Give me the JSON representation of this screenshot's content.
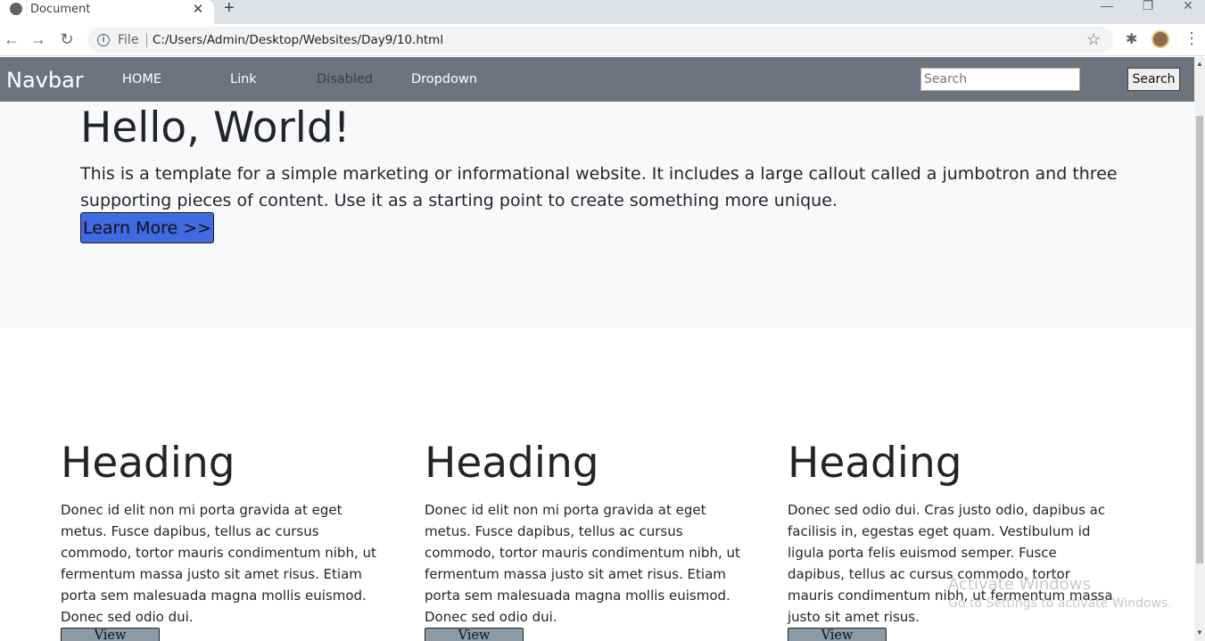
{
  "browser": {
    "tab_title": "Document",
    "new_tab": "+",
    "close_tab": "✕",
    "window_controls": {
      "minimize": "—",
      "restore": "❐",
      "close": "✕"
    },
    "nav": {
      "back": "←",
      "forward": "→",
      "reload": "↻"
    },
    "omnibox": {
      "scheme_label": "File",
      "url": "C:/Users/Admin/Desktop/Websites/Day9/10.html"
    },
    "star": "☆",
    "extensions": "✱",
    "menu": "⋮"
  },
  "navbar": {
    "brand": "Navbar",
    "links": [
      {
        "label": "HOME"
      },
      {
        "label": "Link"
      },
      {
        "label": "Disabled"
      },
      {
        "label": "Dropdown"
      }
    ],
    "search": {
      "placeholder": "Search",
      "button_label": "Search"
    }
  },
  "jumbotron": {
    "title": "Hello, World!",
    "text": "This is a template for a simple marketing or informational website. It includes a large callout called a jumbotron and three supporting pieces of content. Use it as a starting point to create something more unique.",
    "button_label": "Learn More >>"
  },
  "columns": [
    {
      "heading": "Heading",
      "text": "Donec id elit non mi porta gravida at eget metus. Fusce dapibus, tellus ac cursus commodo, tortor mauris condimentum nibh, ut fermentum massa justo sit amet risus. Etiam porta sem malesuada magna mollis euismod. Donec sed odio dui.",
      "button_label": "View Details>>"
    },
    {
      "heading": "Heading",
      "text": "Donec id elit non mi porta gravida at eget metus. Fusce dapibus, tellus ac cursus commodo, tortor mauris condimentum nibh, ut fermentum massa justo sit amet risus. Etiam porta sem malesuada magna mollis euismod. Donec sed odio dui.",
      "button_label": "View Details>>"
    },
    {
      "heading": "Heading",
      "text": "Donec sed odio dui. Cras justo odio, dapibus ac facilisis in, egestas eget quam. Vestibulum id ligula porta felis euismod semper. Fusce dapibus, tellus ac cursus commodo, tortor mauris condimentum nibh, ut fermentum massa justo sit amet risus.",
      "button_label": "View Details>>"
    }
  ],
  "watermark": {
    "line1": "Activate Windows",
    "line2": "Go to Settings to activate Windows."
  },
  "colors": {
    "navbar_bg": "#6c757d",
    "jumbotron_bg": "#f8f9fa",
    "learn_more_bg": "#4169e1",
    "details_btn_bg": "#8a9aa6"
  }
}
